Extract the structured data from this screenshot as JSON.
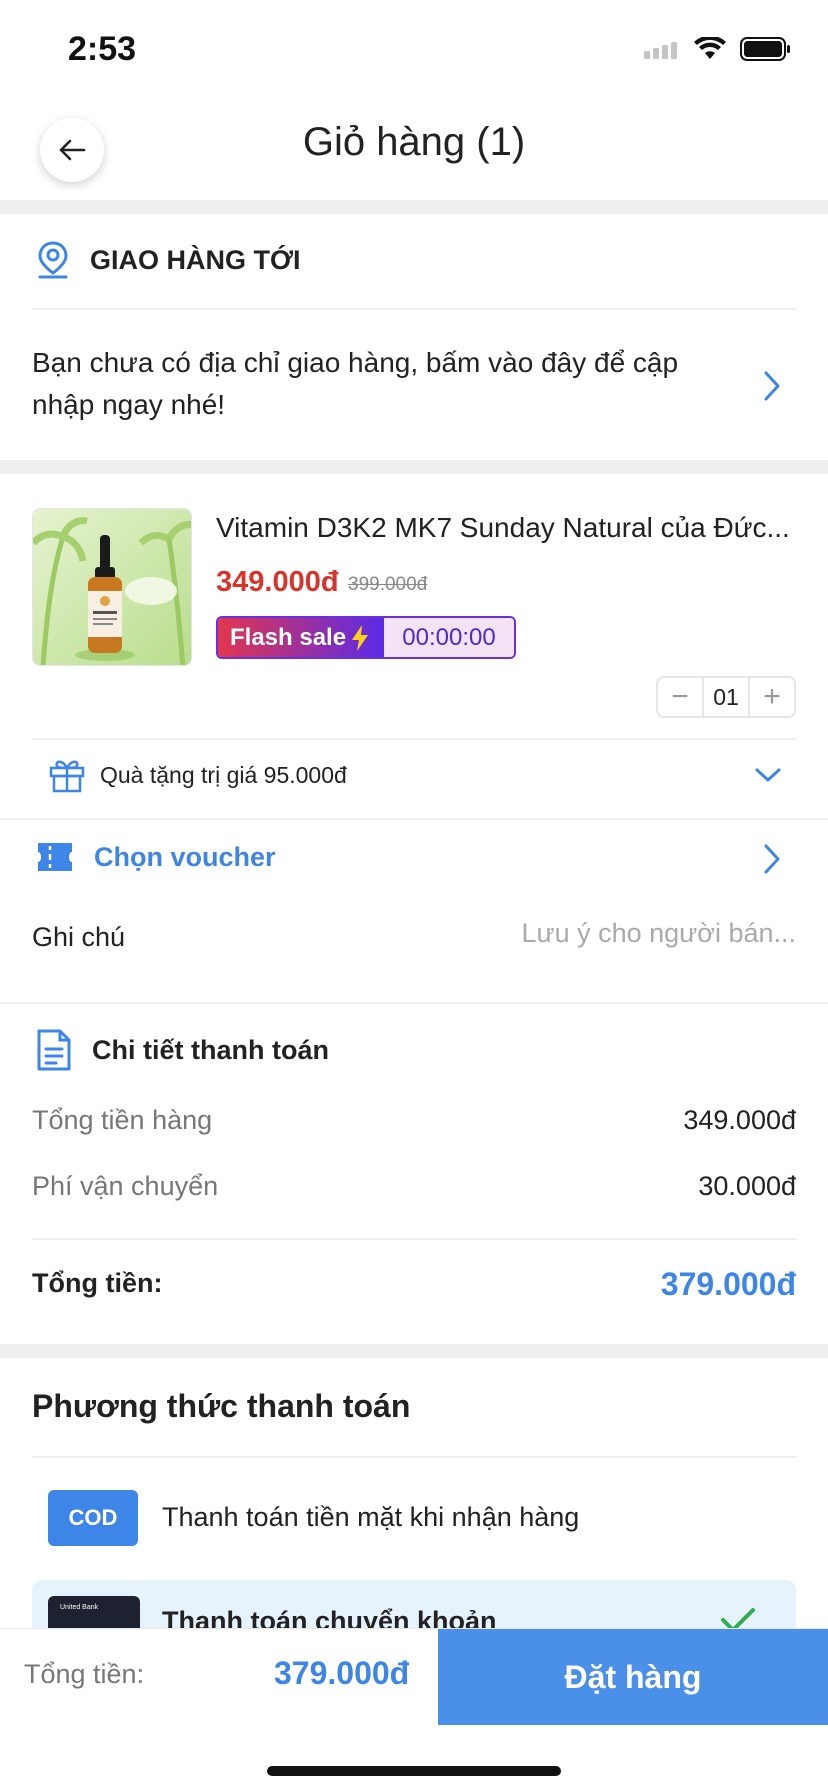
{
  "status_bar": {
    "time": "2:53"
  },
  "header": {
    "title": "Giỏ hàng (1)"
  },
  "shipping": {
    "title": "GIAO HÀNG TỚI",
    "message": "Bạn chưa có địa chỉ giao hàng, bấm vào đây để cập nhập ngay nhé!"
  },
  "product": {
    "name": "Vitamin D3K2 MK7 Sunday Natural của Đức...",
    "price": "349.000đ",
    "old_price": "399.000đ",
    "flash_label": "Flash sale",
    "countdown": "00:00:00",
    "quantity": "01",
    "minus": "−",
    "plus": "+"
  },
  "gift": {
    "label": "Quà tặng trị giá 95.000đ"
  },
  "voucher": {
    "label": "Chọn voucher"
  },
  "note": {
    "label": "Ghi chú",
    "placeholder": "Lưu ý cho người bán..."
  },
  "payment_details": {
    "title": "Chi tiết thanh toán",
    "rows": [
      {
        "label": "Tổng tiền hàng",
        "value": "349.000đ"
      },
      {
        "label": "Phí vận chuyển",
        "value": "30.000đ"
      }
    ],
    "total_label": "Tổng tiền:",
    "total_value": "379.000đ"
  },
  "payment_method": {
    "title": "Phương thức thanh toán",
    "cod_badge": "COD",
    "cod_label": "Thanh toán tiền mặt khi nhận hàng",
    "bank_card_name": "United Bank",
    "bank_label": "Thanh toán chuyển khoản"
  },
  "bottom_bar": {
    "total_label": "Tổng tiền:",
    "total_value": "379.000đ",
    "order_button": "Đặt hàng"
  },
  "colors": {
    "accent": "#3d86e8",
    "price_red": "#d9332a",
    "flash_purple": "#5a2ae8",
    "success_green": "#2fae4e"
  }
}
